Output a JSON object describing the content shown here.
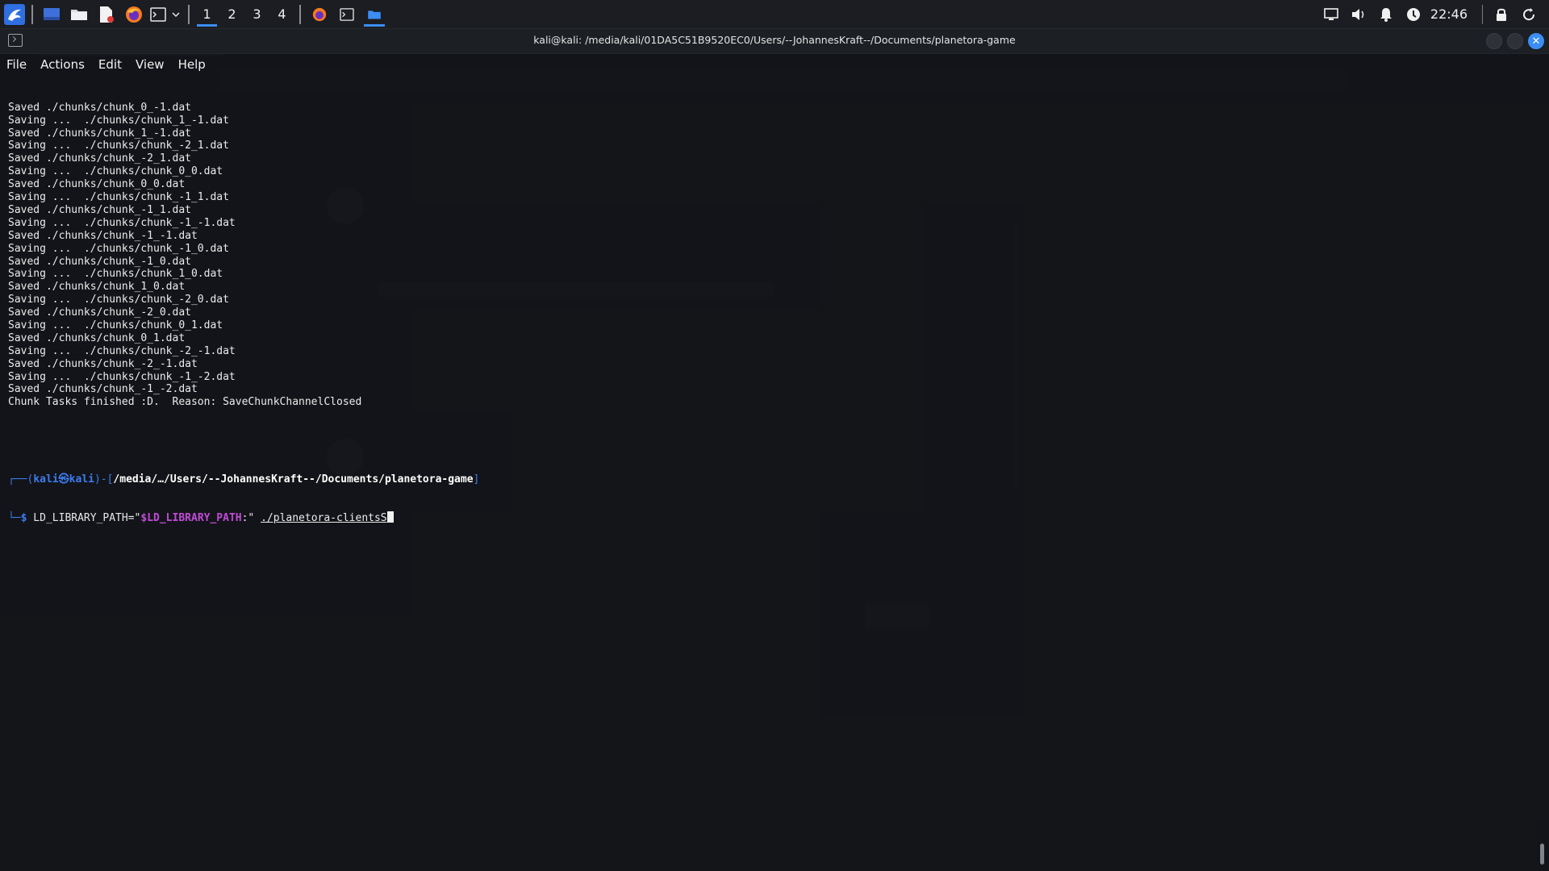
{
  "panel": {
    "workspaces": [
      "1",
      "2",
      "3",
      "4"
    ],
    "active_workspace": "1",
    "clock": "22:46",
    "accent_color": "#3a8ef5"
  },
  "terminal": {
    "window_title": "kali@kali: /media/kali/01DA5C51B9520EC0/Users/--JohannesKraft--/Documents/planetora-game",
    "menu": [
      "File",
      "Actions",
      "Edit",
      "View",
      "Help"
    ],
    "output_lines": [
      "Saved ./chunks/chunk_0_-1.dat",
      "Saving ...  ./chunks/chunk_1_-1.dat",
      "Saved ./chunks/chunk_1_-1.dat",
      "Saving ...  ./chunks/chunk_-2_1.dat",
      "Saved ./chunks/chunk_-2_1.dat",
      "Saving ...  ./chunks/chunk_0_0.dat",
      "Saved ./chunks/chunk_0_0.dat",
      "Saving ...  ./chunks/chunk_-1_1.dat",
      "Saved ./chunks/chunk_-1_1.dat",
      "Saving ...  ./chunks/chunk_-1_-1.dat",
      "Saved ./chunks/chunk_-1_-1.dat",
      "Saving ...  ./chunks/chunk_-1_0.dat",
      "Saved ./chunks/chunk_-1_0.dat",
      "Saving ...  ./chunks/chunk_1_0.dat",
      "Saved ./chunks/chunk_1_0.dat",
      "Saving ...  ./chunks/chunk_-2_0.dat",
      "Saved ./chunks/chunk_-2_0.dat",
      "Saving ...  ./chunks/chunk_0_1.dat",
      "Saved ./chunks/chunk_0_1.dat",
      "Saving ...  ./chunks/chunk_-2_-1.dat",
      "Saved ./chunks/chunk_-2_-1.dat",
      "Saving ...  ./chunks/chunk_-1_-2.dat",
      "Saved ./chunks/chunk_-1_-2.dat",
      "Chunk Tasks finished :D.  Reason: SaveChunkChannelClosed"
    ],
    "prompt": {
      "open": "┌──(",
      "user_host": "kali㉿kali",
      "mid": ")-[",
      "path": "/media/…/Users/--JohannesKraft--/Documents/planetora-game",
      "close": "]",
      "second_line_prefix": "└─",
      "dollar": "$"
    },
    "command": {
      "prefix": " LD_LIBRARY_PATH=\"",
      "var": "$LD_LIBRARY_PATH",
      "mid": ":\" ",
      "file": "./planetora-clientsS"
    }
  }
}
